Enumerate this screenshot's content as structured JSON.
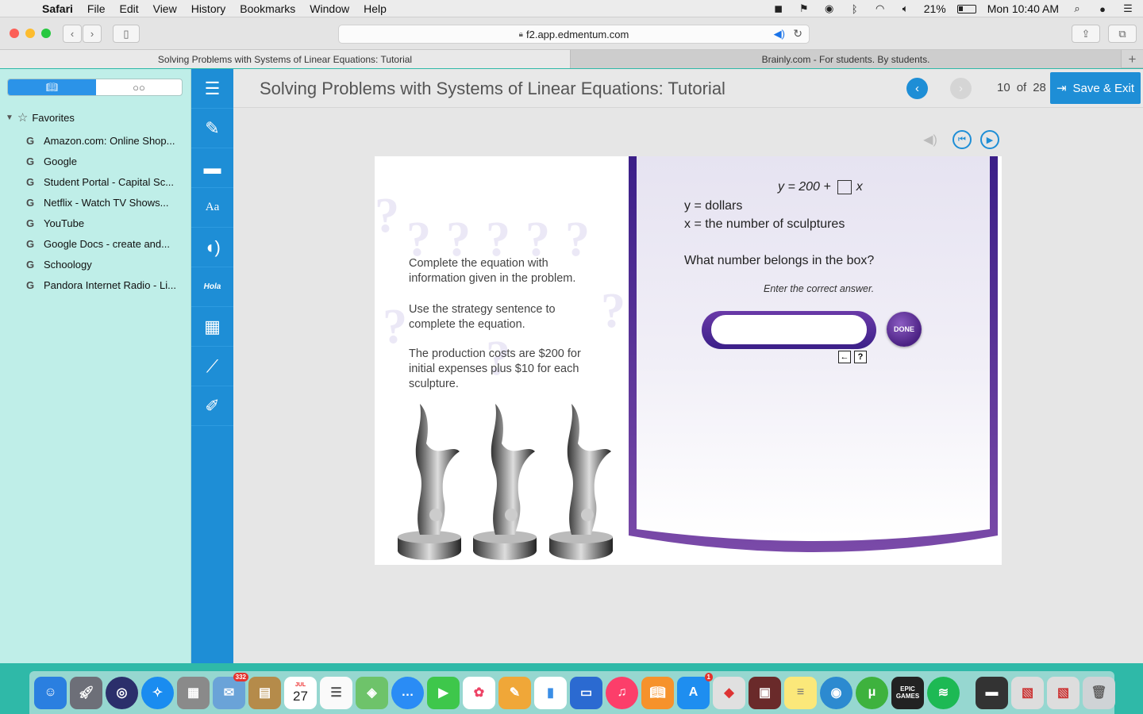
{
  "menubar": {
    "app": "Safari",
    "menus": [
      "File",
      "Edit",
      "View",
      "History",
      "Bookmarks",
      "Window",
      "Help"
    ],
    "battery": "21%",
    "clock": "Mon 10:40 AM"
  },
  "browser": {
    "url": "f2.app.edmentum.com",
    "tabs": [
      "Solving Problems with Systems of Linear Equations: Tutorial",
      "Brainly.com - For students. By students."
    ]
  },
  "sidebar": {
    "favorites_label": "Favorites",
    "items": [
      "Amazon.com: Online Shop...",
      "Google",
      "Student Portal - Capital Sc...",
      "Netflix - Watch TV Shows...",
      "YouTube",
      "Google Docs - create and...",
      "Schoology",
      "Pandora Internet Radio - Li..."
    ]
  },
  "app": {
    "title": "Solving Problems with Systems of Linear Equations: Tutorial",
    "page_current": "10",
    "page_of": "of",
    "page_total": "28",
    "save_exit": "Save & Exit",
    "nav_icons": [
      "menu-icon",
      "notes-icon",
      "folder-icon",
      "dictionary-icon",
      "speech-icon",
      "spanish-icon",
      "calculator-icon",
      "graph-icon",
      "highlighter-icon"
    ],
    "hola_label": "Hola"
  },
  "lesson": {
    "left_text_1": "Complete the equation with information given in the problem.",
    "left_text_2": "Use the strategy sentence to complete the equation.",
    "left_text_3": "The production costs are $200 for initial expenses plus $10 for each sculpture.",
    "equation_prefix": "y = 200 +",
    "equation_suffix": "x",
    "def_y": "y = dollars",
    "def_x": "x = the number of sculptures",
    "question": "What number belongs in the box?",
    "instruction": "Enter the correct answer.",
    "answer_value": "",
    "done_label": "DONE"
  },
  "dock": {
    "mail_badge": "332",
    "appstore_badge": "1",
    "calendar_month": "JUL",
    "calendar_day": "27",
    "epic_label": "EPIC GAMES"
  },
  "colors": {
    "accent_blue": "#1e8ed6",
    "purple": "#4b2183"
  }
}
